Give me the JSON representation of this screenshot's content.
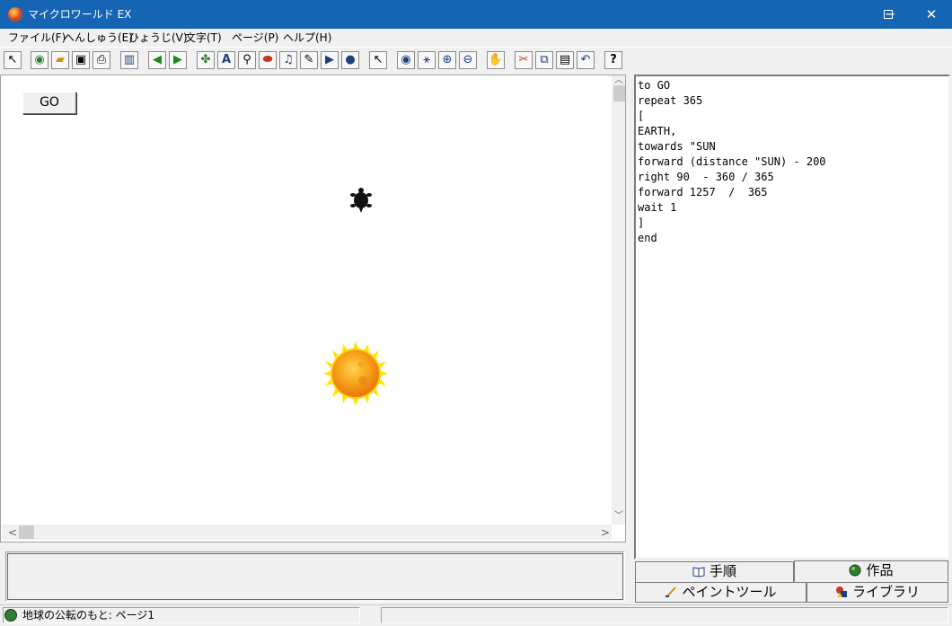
{
  "window": {
    "title": "マイクロワールド EX",
    "minimize_glyph": "─",
    "maximize_glyph": "☐",
    "close_glyph": "✕"
  },
  "menu": [
    {
      "label": "ファイル(F)"
    },
    {
      "label": "へんしゅう(E)"
    },
    {
      "label": "ひょうじ(V)"
    },
    {
      "label": "文字(T)"
    },
    {
      "label": "ページ(P)"
    },
    {
      "label": "ヘルプ(H)"
    }
  ],
  "toolbar": [
    {
      "icon": "select-arrow-icon",
      "glyph": "↖"
    },
    {
      "icon": "globe-icon",
      "glyph": "◉"
    },
    {
      "icon": "open-folder-icon",
      "glyph": "📂"
    },
    {
      "icon": "save-disk-icon",
      "glyph": "▣"
    },
    {
      "icon": "print-icon",
      "glyph": "⎙"
    },
    {
      "icon": "page-layout-icon",
      "glyph": "▥"
    },
    {
      "icon": "previous-page-icon",
      "glyph": "◀"
    },
    {
      "icon": "next-page-icon",
      "glyph": "▶"
    },
    {
      "icon": "new-turtle-icon",
      "glyph": "✤"
    },
    {
      "icon": "text-box-icon",
      "glyph": "A"
    },
    {
      "icon": "slider-icon",
      "glyph": "⚲"
    },
    {
      "icon": "button-tool-icon",
      "glyph": "⬬"
    },
    {
      "icon": "music-icon",
      "glyph": "♫"
    },
    {
      "icon": "pen-icon",
      "glyph": "✎"
    },
    {
      "icon": "video-icon",
      "glyph": "▶"
    },
    {
      "icon": "record-icon",
      "glyph": "●"
    },
    {
      "icon": "pointer-icon",
      "glyph": "↖"
    },
    {
      "icon": "eye-icon",
      "glyph": "◉"
    },
    {
      "icon": "stamp-icon",
      "glyph": "⚹"
    },
    {
      "icon": "zoom-in-icon",
      "glyph": "⊕"
    },
    {
      "icon": "zoom-out-icon",
      "glyph": "⊖"
    },
    {
      "icon": "stop-hand-icon",
      "glyph": "✋"
    },
    {
      "icon": "cut-icon",
      "glyph": "✂"
    },
    {
      "icon": "copy-icon",
      "glyph": "⧉"
    },
    {
      "icon": "paste-icon",
      "glyph": "📋"
    },
    {
      "icon": "undo-icon",
      "glyph": "↶"
    },
    {
      "icon": "help-icon",
      "glyph": "?"
    }
  ],
  "stage": {
    "go_button_label": "GO"
  },
  "scrollbar": {
    "up_glyph": "︿",
    "down_glyph": "﹀",
    "left_glyph": "<",
    "right_glyph": ">"
  },
  "procedures": {
    "code": "to GO\nrepeat 365\n[\nEARTH,\ntowards \"SUN\nforward (distance \"SUN) - 200\nright 90  - 360 / 365\nforward 1257  /  365\nwait 1\n]\nend"
  },
  "tabs": [
    {
      "label": "手順",
      "icon": "book-icon"
    },
    {
      "label": "作品",
      "icon": "globe-icon"
    },
    {
      "label": "ペイントツール",
      "icon": "paintbrush-icon"
    },
    {
      "label": "ライブラリ",
      "icon": "shapes-icon"
    }
  ],
  "status": {
    "text": "地球の公転のもと: ページ1"
  },
  "colors": {
    "titlebar": "#1565b4",
    "sun": "#f7a21b",
    "turtle": "#111111"
  }
}
